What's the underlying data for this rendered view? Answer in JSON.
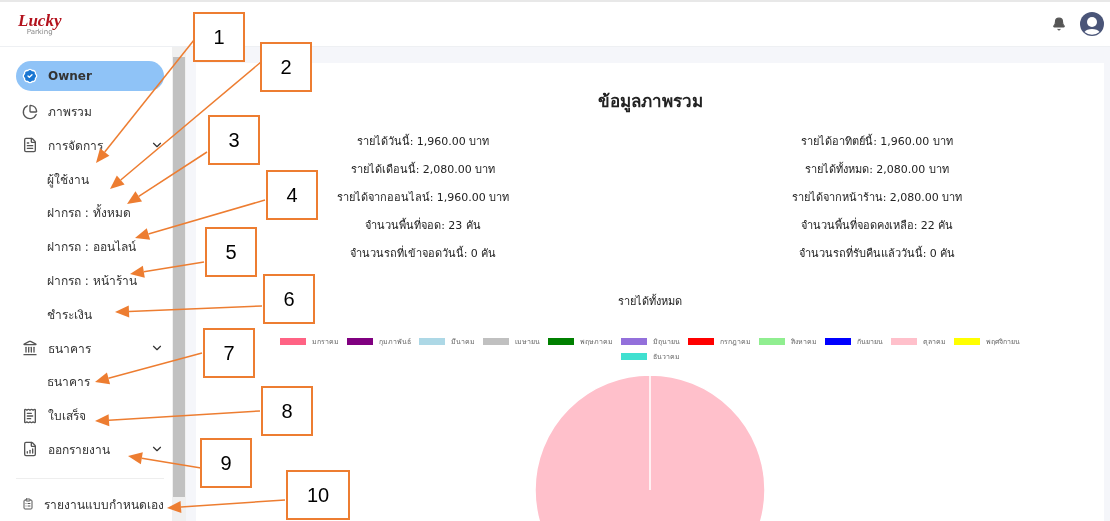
{
  "logo": {
    "name": "Lucky",
    "tagline": "Parking"
  },
  "sidebar": {
    "items": [
      {
        "label": "Owner",
        "kind": "profile",
        "selected": true
      },
      {
        "label": "ภาพรวม",
        "kind": "link",
        "selected": false
      },
      {
        "label": "การจัดการ",
        "kind": "group",
        "selected": false,
        "children": [
          {
            "label": "ผู้ใช้งาน"
          },
          {
            "label": "ฝากรถ : ทั้งหมด"
          },
          {
            "label": "ฝากรถ : ออนไลน์"
          },
          {
            "label": "ฝากรถ : หน้าร้าน"
          },
          {
            "label": "ชำระเงิน"
          }
        ]
      },
      {
        "label": "ธนาคาร",
        "kind": "group",
        "selected": false,
        "children": [
          {
            "label": "ธนาคาร"
          }
        ]
      },
      {
        "label": "ใบเสร็จ",
        "kind": "link",
        "selected": false
      },
      {
        "label": "ออกรายงาน",
        "kind": "group",
        "selected": false
      },
      {
        "label": "รายงานแบบกำหนดเอง",
        "kind": "link",
        "selected": false
      }
    ]
  },
  "overview": {
    "title": "ข้อมูลภาพรวม",
    "left_column": [
      "รายได้วันนี้: 1,960.00 บาท",
      "รายได้เดือนนี้: 2,080.00 บาท",
      "รายได้จากออนไลน์: 1,960.00 บาท",
      "จำนวนพื้นที่จอด: 23 คัน",
      "จำนวนรถที่เข้าจอดวันนี้: 0 คัน"
    ],
    "right_column": [
      "รายได้อาทิตย์นี้: 1,960.00 บาท",
      "รายได้ทั้งหมด: 2,080.00 บาท",
      "รายได้จากหน้าร้าน: 2,080.00 บาท",
      "จำนวนพื้นที่จอดคงเหลือ: 22 คัน",
      "จำนวนรถที่รับคืนแล้ววันนี้: 0 คัน"
    ],
    "chart_data": {
      "type": "pie",
      "title": "รายได้ทั้งหมด",
      "categories": [
        "มกราคม",
        "กุมภาพันธ์",
        "มีนาคม",
        "เมษายน",
        "พฤษภาคม",
        "มิถุนายน",
        "กรกฎาคม",
        "สิงหาคม",
        "กันยายน",
        "ตุลาคม",
        "พฤศจิกายน",
        "ธันวาคม"
      ],
      "series": [
        {
          "colors": [
            "#ff6384",
            "#800080",
            "#add8e6",
            "#c0c0c0",
            "#008000",
            "#9370db",
            "#ff0000",
            "#90ee90",
            "#0000ff",
            "#ffc0cb",
            "#ffff00",
            "#40e0d0"
          ],
          "values": [
            0,
            0,
            0,
            0,
            0,
            0,
            0,
            0,
            0,
            100,
            0,
            0
          ]
        }
      ]
    }
  },
  "callouts": [
    {
      "label": "1"
    },
    {
      "label": "2"
    },
    {
      "label": "3"
    },
    {
      "label": "4"
    },
    {
      "label": "5"
    },
    {
      "label": "6"
    },
    {
      "label": "7"
    },
    {
      "label": "8"
    },
    {
      "label": "9"
    },
    {
      "label": "10"
    }
  ]
}
